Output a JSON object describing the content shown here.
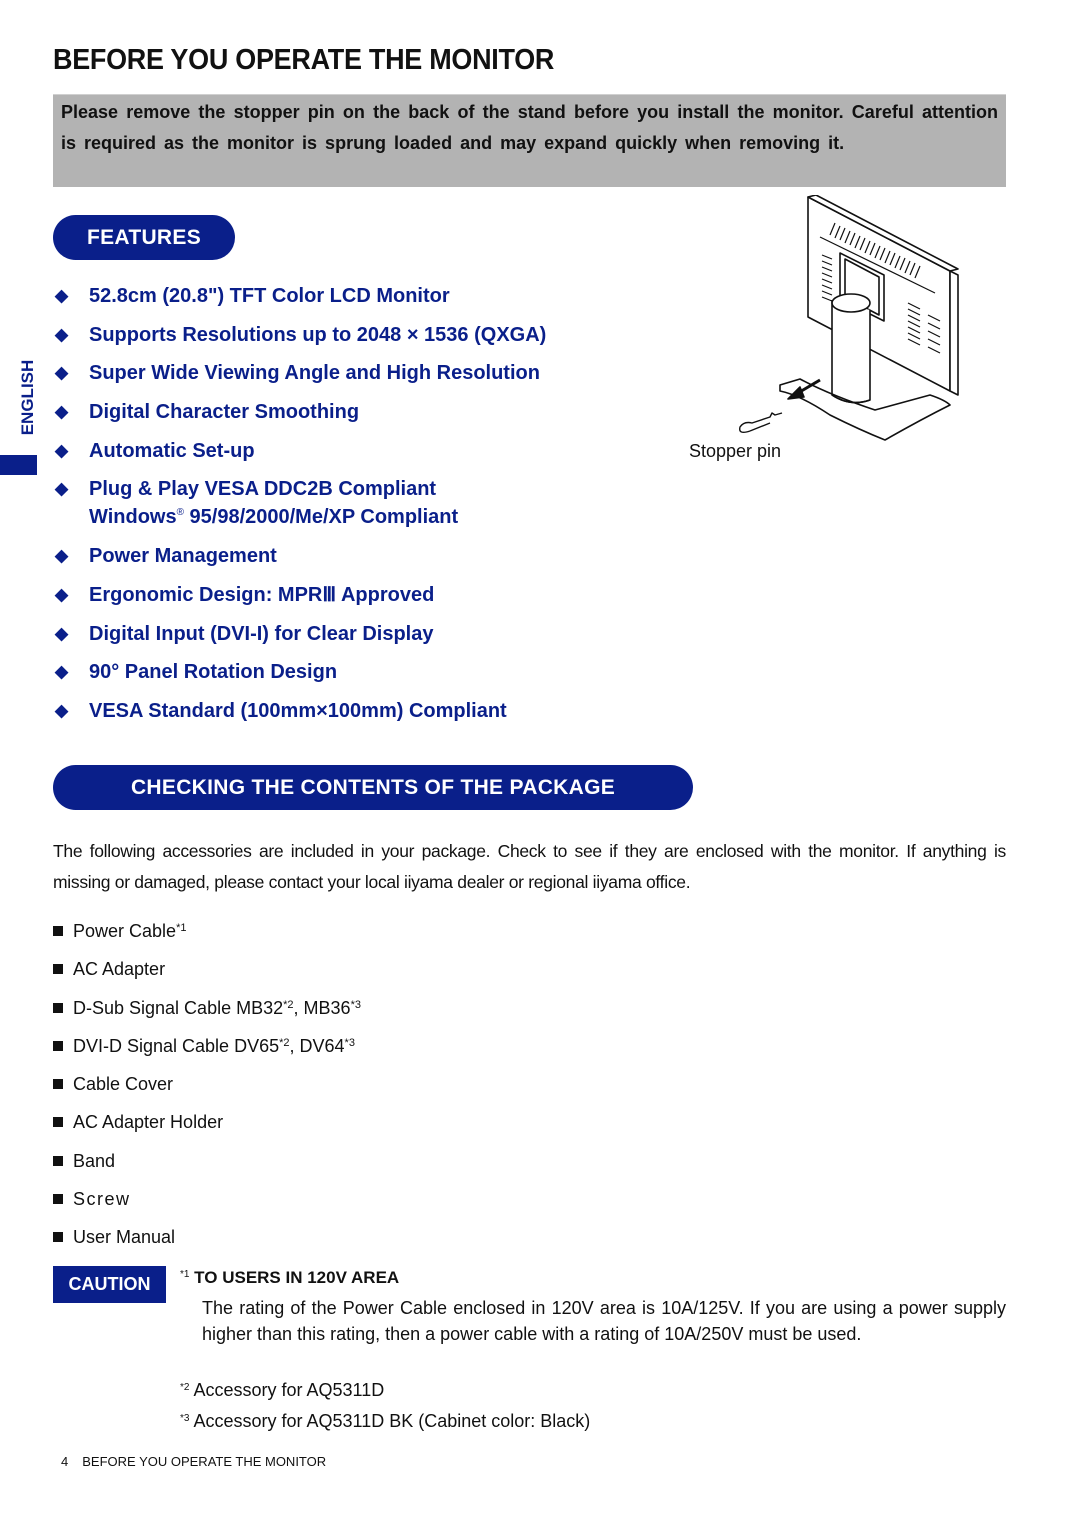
{
  "page": {
    "title": "BEFORE YOU OPERATE THE MONITOR",
    "notice": "Please remove the stopper pin on the back of the stand before you install the monitor. Careful attention is required as the monitor is sprung loaded and may expand quickly when removing it.",
    "language_tab": "ENGLISH"
  },
  "features": {
    "heading": "FEATURES",
    "bullet_icon": "diamond",
    "items": [
      {
        "text": "52.8cm (20.8\") TFT Color LCD Monitor"
      },
      {
        "text": "Supports Resolutions up to 2048 × 1536 (QXGA)"
      },
      {
        "text": "Super Wide Viewing Angle and High Resolution"
      },
      {
        "text": "Digital Character Smoothing"
      },
      {
        "text": "Automatic Set-up"
      },
      {
        "text": "Plug & Play VESA DDC2B Compliant",
        "line2_prefix": "Windows",
        "line2_mark": "®",
        "line2_rest": " 95/98/2000/Me/XP Compliant"
      },
      {
        "text": "Power Management"
      },
      {
        "text": "Ergonomic Design: MPRⅢ Approved"
      },
      {
        "text": "Digital Input (DVI-I) for Clear Display"
      },
      {
        "text": "90° Panel Rotation Design"
      },
      {
        "text": "VESA Standard (100mm×100mm) Compliant"
      }
    ],
    "illustration_caption": "Stopper pin"
  },
  "package": {
    "heading": "CHECKING THE CONTENTS OF THE PACKAGE",
    "intro": "The following accessories are included in your package. Check to see if they are enclosed with the monitor. If anything is missing or damaged, please contact your local iiyama dealer or regional iiyama office.",
    "items": [
      {
        "a": "Power Cable",
        "a_note": "*1",
        "b": "",
        "b_note": ""
      },
      {
        "a": "AC Adapter",
        "a_note": "",
        "b": "",
        "b_note": ""
      },
      {
        "a": "D-Sub Signal Cable MB32",
        "a_note": "*2",
        "b": ", MB36",
        "b_note": "*3"
      },
      {
        "a": "DVI-D Signal Cable DV65",
        "a_note": "*2",
        "b": ", DV64",
        "b_note": "*3"
      },
      {
        "a": "Cable Cover",
        "a_note": "",
        "b": "",
        "b_note": ""
      },
      {
        "a": "AC Adapter Holder",
        "a_note": "",
        "b": "",
        "b_note": ""
      },
      {
        "a": "Band",
        "a_note": "",
        "b": "",
        "b_note": ""
      },
      {
        "a": "Screw",
        "a_note": "",
        "b": "",
        "b_note": ""
      },
      {
        "a": "User Manual",
        "a_note": "",
        "b": "",
        "b_note": ""
      }
    ]
  },
  "caution": {
    "badge": "CAUTION",
    "note1_mark": "*1",
    "note1_title": " TO USERS IN 120V AREA",
    "note1_body": "The rating of the Power Cable enclosed in 120V area is 10A/125V. If you are using a power supply higher than this rating, then a power cable with a rating of 10A/250V must be used.",
    "note2_mark": "*2",
    "note2_text": " Accessory for AQ5311D",
    "note3_mark": "*3",
    "note3_text": " Accessory for AQ5311D BK (Cabinet color: Black)"
  },
  "footer": {
    "page_number": "4",
    "section": "BEFORE YOU OPERATE THE MONITOR"
  },
  "colors": {
    "accent_blue": "#0a1f8a",
    "notice_gray": "#b3b3b3"
  }
}
